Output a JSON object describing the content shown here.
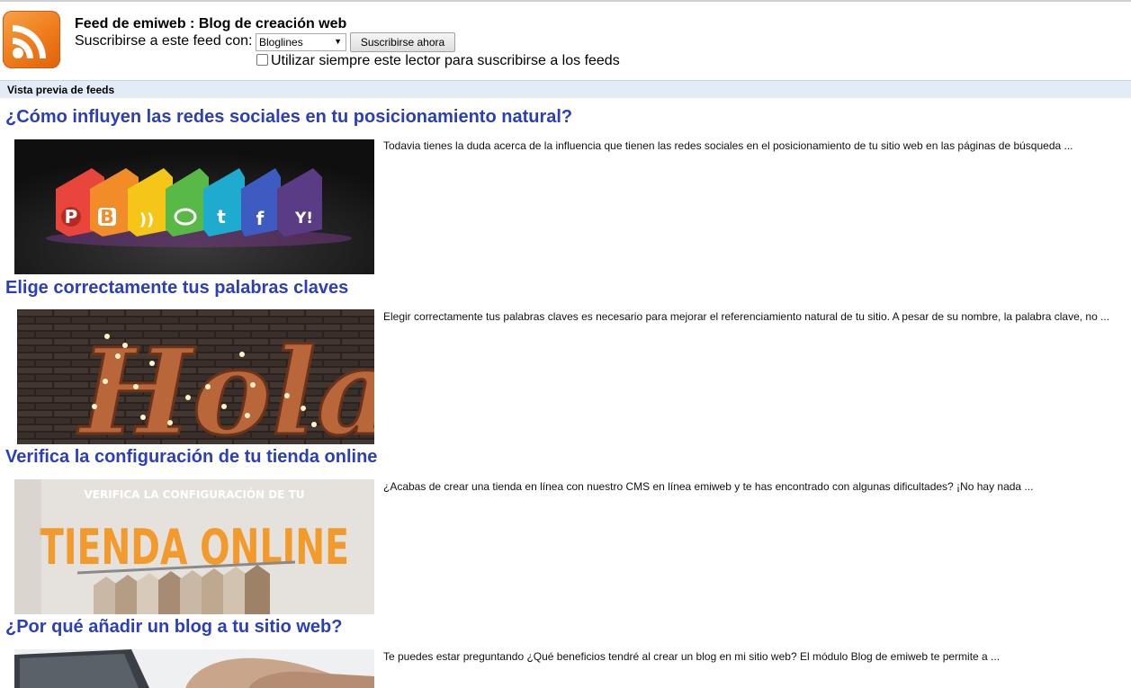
{
  "header": {
    "logo": "rss-feed-icon",
    "feed_title": "Feed de emiweb : Blog de creación web",
    "subscribe_label": "Suscribirse a este feed con:",
    "reader_selected": "Bloglines",
    "subscribe_button": "Suscribirse ahora",
    "always_use_label": "Utilizar siempre este lector para suscribirse a los feeds",
    "always_use_checked": false
  },
  "preview_heading": "Vista previa de feeds",
  "colors": {
    "link": "#2b3fb9",
    "bar": "#e3ecf6",
    "rss": "#ef7b1a"
  },
  "entries": [
    {
      "title": "¿Cómo influyen las redes sociales en tu posicionamiento natural?",
      "summary": "Todavia tienes la duda acerca de la influencia que tienen las redes sociales en el posicionamiento de tu sitio web en las páginas de búsqueda ...",
      "image": "social-media-chalk-image"
    },
    {
      "title": "Elige correctamente tus palabras claves",
      "summary": "Elegir correctamente tus palabras claves es necesario para mejorar el referenciamiento natural de tu sitio. A pesar de su nombre, la palabra clave, no ...",
      "image": "hola-marquee-sign-image",
      "image_text": "Hola"
    },
    {
      "title": "Verifica la configuración de tu tienda online",
      "summary": "¿Acabas de crear una tienda en línea con nuestro CMS en línea emiweb y te has encontrado con algunas dificultades? ¡No hay nada ...",
      "image": "tienda-online-banner-image",
      "image_caption": "VERIFICA LA CONFIGURACIÓN DE TU",
      "image_heading": "TIENDA ONLINE"
    },
    {
      "title": "¿Por qué añadir un blog a tu sitio web?",
      "summary": "Te puedes estar preguntando ¿Qué beneficios tendré al crear un blog en mi sitio web? El módulo Blog de emiweb te permite a ...",
      "image": "laptop-typing-image"
    }
  ]
}
